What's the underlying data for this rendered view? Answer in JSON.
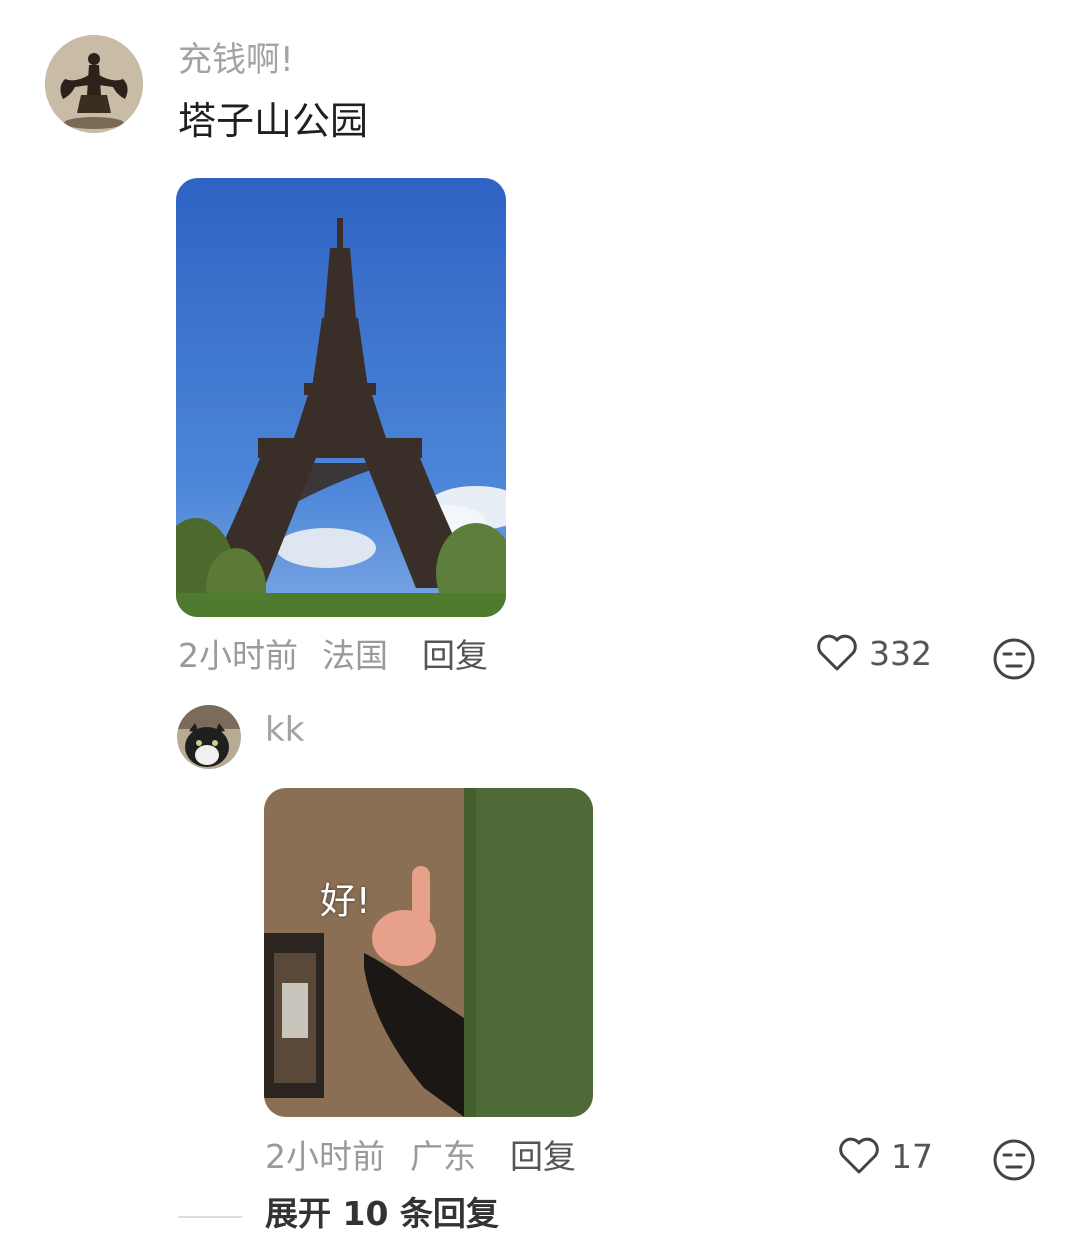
{
  "comment": {
    "username": "充钱啊!",
    "text": "塔子山公园",
    "time": "2小时前",
    "location": "法国",
    "reply_label": "回复",
    "like_count": "332"
  },
  "reply": {
    "username": "kk",
    "sticker_text": "好!",
    "time": "2小时前",
    "location": "广东",
    "reply_label": "回复",
    "like_count": "17"
  },
  "expand_replies": "展开 10 条回复",
  "icons": {
    "like": "heart-outline-icon",
    "dislike": "meh-face-icon"
  },
  "colors": {
    "username": "#a3a3a3",
    "meta": "#9a9a9a",
    "sky": "#3f76cf"
  }
}
